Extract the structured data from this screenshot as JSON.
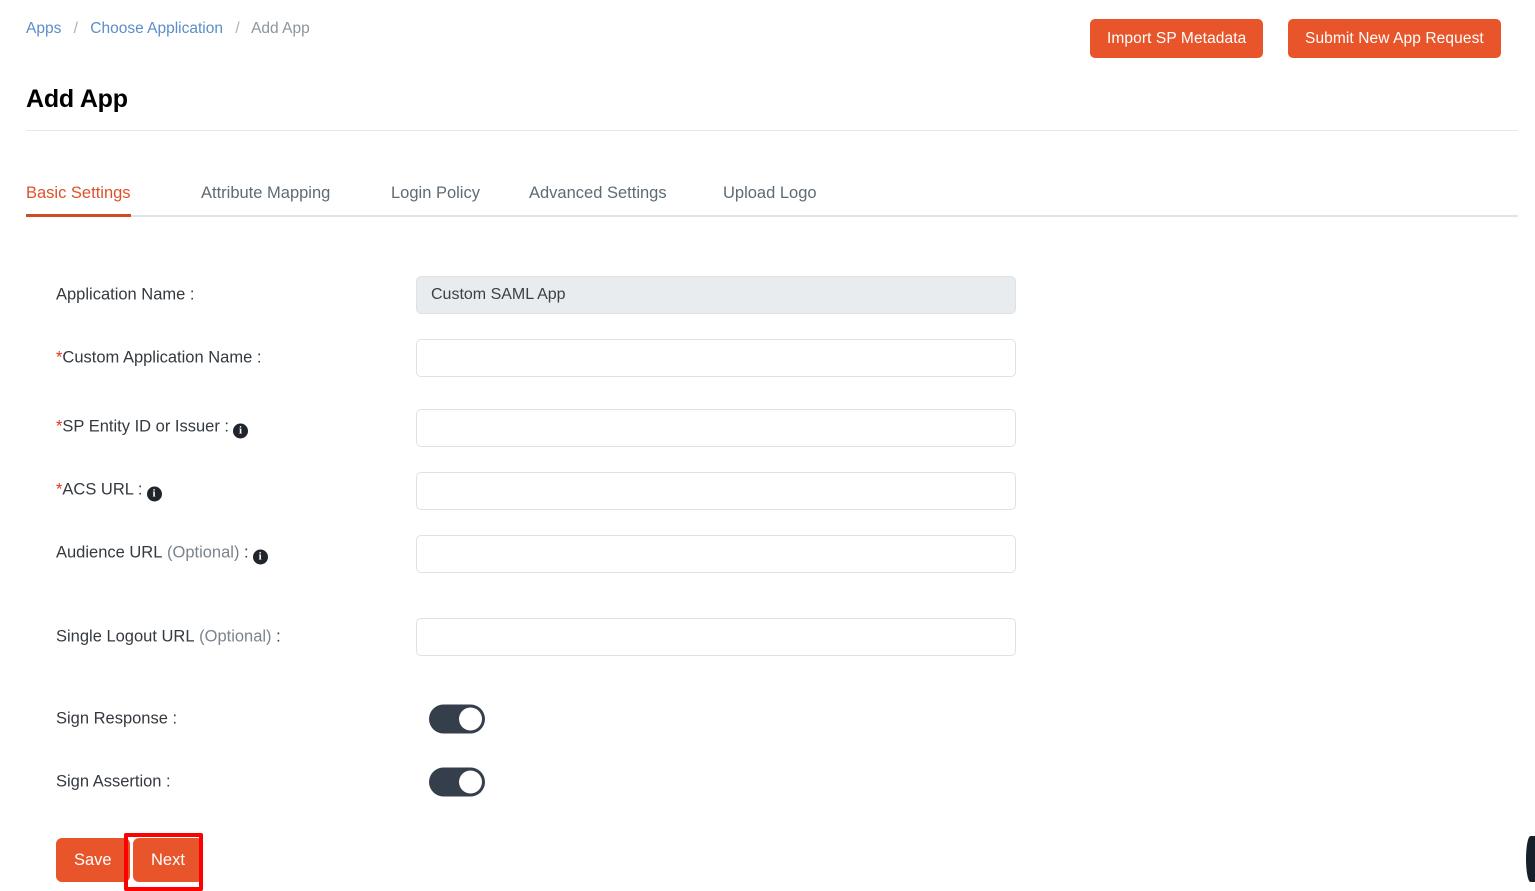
{
  "breadcrumb": {
    "items": [
      {
        "label": "Apps",
        "type": "link"
      },
      {
        "label": "Choose Application",
        "type": "link"
      },
      {
        "label": "Add App",
        "type": "current"
      }
    ],
    "separator": "/"
  },
  "header": {
    "title": "Add App",
    "actions": {
      "import_sp_metadata": "Import SP Metadata",
      "submit_new_app_request": "Submit New App Request"
    }
  },
  "tabs": [
    {
      "label": "Basic Settings",
      "active": true
    },
    {
      "label": "Attribute Mapping",
      "active": false
    },
    {
      "label": "Login Policy",
      "active": false
    },
    {
      "label": "Advanced Settings",
      "active": false
    },
    {
      "label": "Upload Logo",
      "active": false
    }
  ],
  "form": {
    "application_name": {
      "label": "Application Name :",
      "value": "Custom SAML App",
      "placeholder": "",
      "disabled": true
    },
    "custom_application_name": {
      "required_marker": "*",
      "label": "Custom Application Name :",
      "value": "",
      "placeholder": ""
    },
    "sp_entity_id": {
      "required_marker": "*",
      "label": "SP Entity ID or Issuer :",
      "info_glyph": "i",
      "value": "",
      "placeholder": ""
    },
    "acs_url": {
      "required_marker": "*",
      "label": "ACS URL :",
      "info_glyph": "i",
      "value": "",
      "placeholder": ""
    },
    "audience_url": {
      "label": "Audience URL",
      "optional": "(Optional)",
      "colon": ":",
      "info_glyph": "i",
      "value": "",
      "placeholder": ""
    },
    "single_logout_url": {
      "label": "Single Logout URL",
      "optional": "(Optional)",
      "colon": ":",
      "value": "",
      "placeholder": ""
    },
    "sign_response": {
      "label": "Sign Response :",
      "state": "on"
    },
    "sign_assertion": {
      "label": "Sign Assertion :",
      "state": "on"
    }
  },
  "footer": {
    "save_label": "Save",
    "next_label": "Next"
  },
  "colors": {
    "accent_orange": "#e8552b",
    "tab_active": "#e0512a",
    "tab_underline": "#cf4a26",
    "link_blue": "#5b8dc8",
    "toggle_on": "#343f4b",
    "required_red": "#e0341f",
    "highlight_red": "#fe0000",
    "disabled_field_bg": "#e9ecef"
  }
}
